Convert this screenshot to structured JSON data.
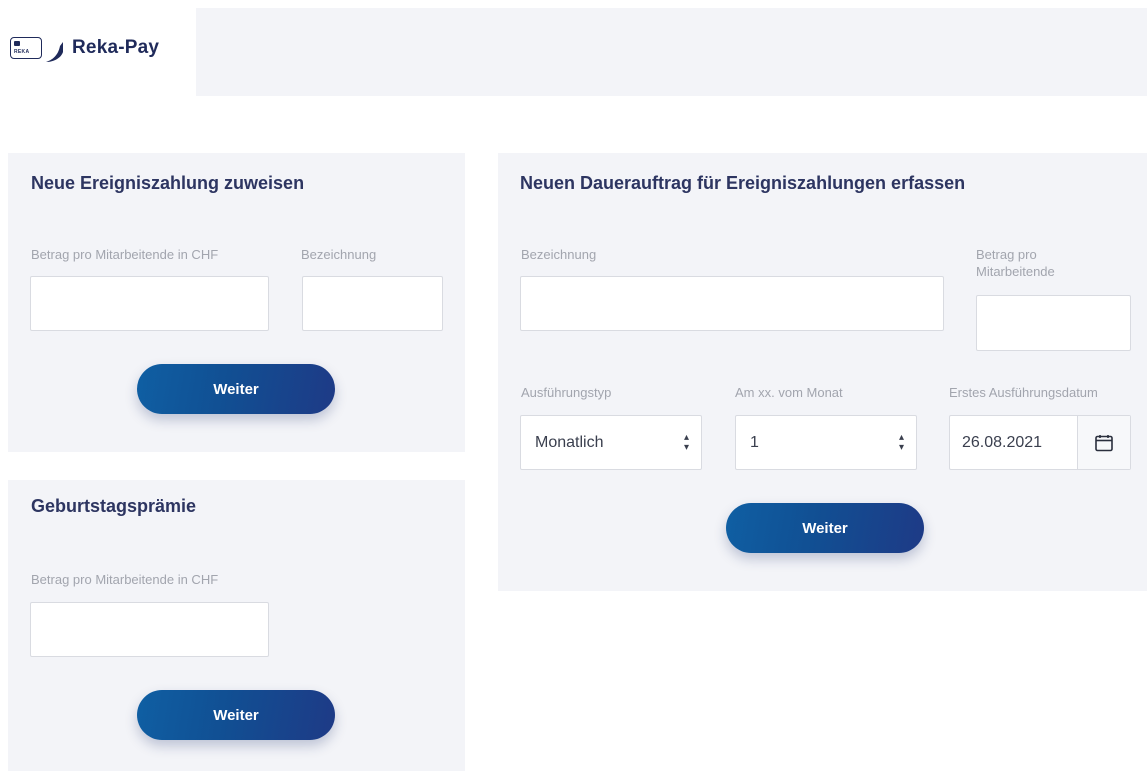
{
  "header": {
    "logo_card_text": "REKA",
    "logo_text": "Reka-Pay"
  },
  "panel_event": {
    "title": "Neue Ereigniszahlung zuweisen",
    "amount_label": "Betrag pro Mitarbeitende in CHF",
    "amount_value": "",
    "description_label": "Bezeichnung",
    "description_value": "",
    "button_label": "Weiter"
  },
  "panel_birthday": {
    "title": "Geburtstagsprämie",
    "amount_label": "Betrag pro Mitarbeitende in CHF",
    "amount_value": "",
    "button_label": "Weiter"
  },
  "panel_standing_order": {
    "title": "Neuen Dauerauftrag für Ereigniszahlungen erfassen",
    "description_label": "Bezeichnung",
    "description_value": "",
    "amount_label_line1": "Betrag pro",
    "amount_label_line2": "Mitarbeitende",
    "amount_value": "",
    "execution_type_label": "Ausführungstyp",
    "execution_type_value": "Monatlich",
    "day_of_month_label": "Am xx. vom Monat",
    "day_of_month_value": "1",
    "first_date_label": "Erstes Ausführungsdatum",
    "first_date_value": "26.08.2021",
    "button_label": "Weiter"
  },
  "icons": {
    "select_arrows": "⇕",
    "calendar": "calendar-icon"
  },
  "colors": {
    "brand_navy": "#1f2a5a",
    "button_blue": "#114f93",
    "panel_bg": "#f3f4f8"
  }
}
